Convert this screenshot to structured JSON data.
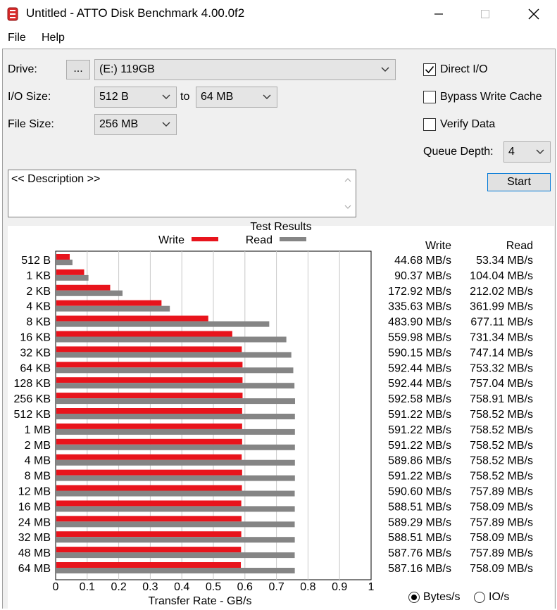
{
  "window": {
    "title": "Untitled - ATTO Disk Benchmark 4.00.0f2"
  },
  "menu": {
    "file": "File",
    "help": "Help"
  },
  "settings": {
    "drive_label": "Drive:",
    "browse_label": "...",
    "drive_value": "(E:) 119GB",
    "io_size_label": "I/O Size:",
    "io_from": "512 B",
    "to_label": "to",
    "io_to": "64 MB",
    "file_size_label": "File Size:",
    "file_size_value": "256 MB",
    "direct_io_label": "Direct I/O",
    "bypass_label": "Bypass Write Cache",
    "verify_label": "Verify Data",
    "queue_label": "Queue Depth:",
    "queue_value": "4",
    "start_label": "Start",
    "description": "<< Description >>"
  },
  "options": {
    "direct_io": true,
    "bypass_write_cache": false,
    "verify_data": false,
    "mode_bytes": true,
    "mode_io": false
  },
  "units": {
    "bytes_label": "Bytes/s",
    "io_label": "IO/s"
  },
  "results": {
    "col_write": "Write",
    "col_read": "Read"
  },
  "chart_data": {
    "type": "bar",
    "orientation": "horizontal",
    "title": "Test Results",
    "xlabel": "Transfer Rate - GB/s",
    "xlim": [
      0,
      1
    ],
    "xticks": [
      "0",
      "0.1",
      "0.2",
      "0.3",
      "0.4",
      "0.5",
      "0.6",
      "0.7",
      "0.8",
      "0.9",
      "1"
    ],
    "grid": true,
    "legend": "top-center",
    "categories": [
      "512 B",
      "1 KB",
      "2 KB",
      "4 KB",
      "8 KB",
      "16 KB",
      "32 KB",
      "64 KB",
      "128 KB",
      "256 KB",
      "512 KB",
      "1 MB",
      "2 MB",
      "4 MB",
      "8 MB",
      "12 MB",
      "16 MB",
      "24 MB",
      "32 MB",
      "48 MB",
      "64 MB"
    ],
    "series": [
      {
        "name": "Write",
        "color": "#e8141c",
        "values": [
          0.04468,
          0.09037,
          0.17292,
          0.33563,
          0.4839,
          0.55998,
          0.59015,
          0.59244,
          0.59244,
          0.59258,
          0.59122,
          0.59122,
          0.59122,
          0.58986,
          0.59122,
          0.5906,
          0.58851,
          0.58929,
          0.58851,
          0.58776,
          0.58716
        ],
        "labels": [
          "44.68 MB/s",
          "90.37 MB/s",
          "172.92 MB/s",
          "335.63 MB/s",
          "483.90 MB/s",
          "559.98 MB/s",
          "590.15 MB/s",
          "592.44 MB/s",
          "592.44 MB/s",
          "592.58 MB/s",
          "591.22 MB/s",
          "591.22 MB/s",
          "591.22 MB/s",
          "589.86 MB/s",
          "591.22 MB/s",
          "590.60 MB/s",
          "588.51 MB/s",
          "589.29 MB/s",
          "588.51 MB/s",
          "587.76 MB/s",
          "587.16 MB/s"
        ]
      },
      {
        "name": "Read",
        "color": "#858585",
        "values": [
          0.05334,
          0.10404,
          0.21202,
          0.36199,
          0.67711,
          0.73134,
          0.74714,
          0.75332,
          0.75704,
          0.75891,
          0.75852,
          0.75852,
          0.75852,
          0.75852,
          0.75852,
          0.75789,
          0.75809,
          0.75789,
          0.75809,
          0.75789,
          0.75809
        ],
        "labels": [
          "53.34 MB/s",
          "104.04 MB/s",
          "212.02 MB/s",
          "361.99 MB/s",
          "677.11 MB/s",
          "731.34 MB/s",
          "747.14 MB/s",
          "753.32 MB/s",
          "757.04 MB/s",
          "758.91 MB/s",
          "758.52 MB/s",
          "758.52 MB/s",
          "758.52 MB/s",
          "758.52 MB/s",
          "758.52 MB/s",
          "757.89 MB/s",
          "758.09 MB/s",
          "757.89 MB/s",
          "758.09 MB/s",
          "757.89 MB/s",
          "758.09 MB/s"
        ]
      }
    ]
  }
}
